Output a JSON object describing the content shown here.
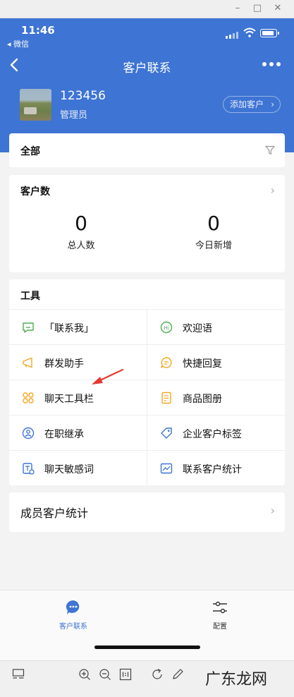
{
  "status_bar": {
    "time": "11:46",
    "back_app": "◂ 微信"
  },
  "nav": {
    "title": "客户联系"
  },
  "user": {
    "name": "123456",
    "role": "管理员",
    "add_button": "添加客户"
  },
  "filter": {
    "label": "全部"
  },
  "customer_count": {
    "label": "客户数",
    "stats": [
      {
        "value": "0",
        "caption": "总人数"
      },
      {
        "value": "0",
        "caption": "今日新增"
      }
    ]
  },
  "tools": {
    "label": "工具",
    "items": [
      {
        "label": "「联系我」",
        "icon": "contact-me-icon",
        "color": "#4caf50"
      },
      {
        "label": "欢迎语",
        "icon": "welcome-hi-icon",
        "color": "#4caf50"
      },
      {
        "label": "群发助手",
        "icon": "mass-message-icon",
        "color": "#f5a623"
      },
      {
        "label": "快捷回复",
        "icon": "quick-reply-icon",
        "color": "#f5a623"
      },
      {
        "label": "聊天工具栏",
        "icon": "chat-toolbar-icon",
        "color": "#f5a623"
      },
      {
        "label": "商品图册",
        "icon": "product-album-icon",
        "color": "#f5a623"
      },
      {
        "label": "在职继承",
        "icon": "inheritance-icon",
        "color": "#3e74d3"
      },
      {
        "label": "企业客户标签",
        "icon": "tag-icon",
        "color": "#3e74d3"
      },
      {
        "label": "聊天敏感词",
        "icon": "sensitive-words-icon",
        "color": "#3e74d3"
      },
      {
        "label": "联系客户统计",
        "icon": "statistics-icon",
        "color": "#3e74d3"
      }
    ]
  },
  "member_stats": {
    "label": "成员客户统计"
  },
  "tabbar": {
    "tabs": [
      {
        "label": "客户联系",
        "active": true
      },
      {
        "label": "配置",
        "active": false
      }
    ]
  },
  "watermark": "广东龙网",
  "colors": {
    "brand_blue": "#3e74d3",
    "arrow_red": "#e53935"
  }
}
